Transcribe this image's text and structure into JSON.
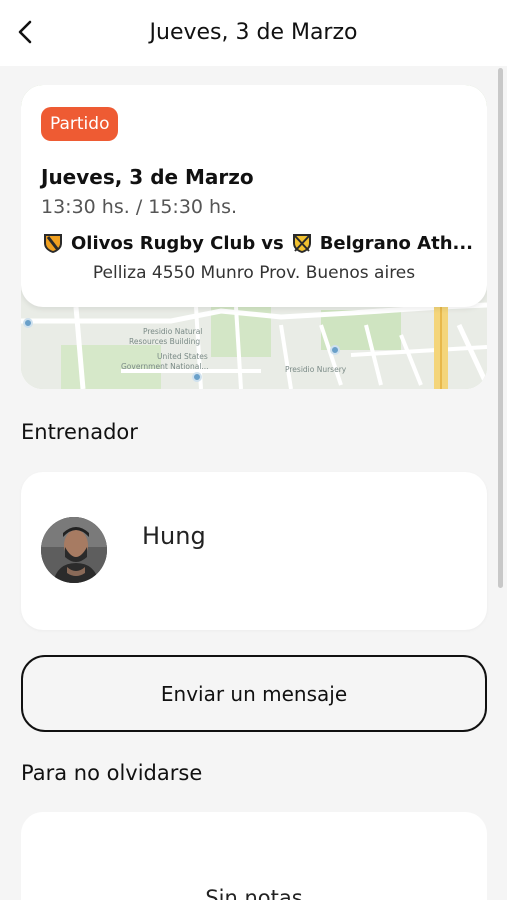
{
  "header": {
    "title": "Jueves, 3 de Marzo",
    "back_icon": "chevron-left-icon"
  },
  "event": {
    "badge": "Partido",
    "badge_color": "#ee5b33",
    "date": "Jueves, 3 de Marzo",
    "time": "13:30 hs. / 15:30 hs.",
    "home_team": "Olivos Rugby Club",
    "vs": "vs",
    "away_team": "Belgrano Ath...",
    "address": "Pelliza 4550 Munro Prov. Buenos aires"
  },
  "map": {
    "labels": [
      "Presidio Natural",
      "Resources Building",
      "United States",
      "Government National...",
      "Presidio Nursery"
    ]
  },
  "coach": {
    "section_title": "Entrenador",
    "name": "Hung"
  },
  "actions": {
    "message_label": "Enviar un mensaje"
  },
  "notes": {
    "section_title": "Para no olvidarse",
    "empty_label": "Sin notas"
  }
}
